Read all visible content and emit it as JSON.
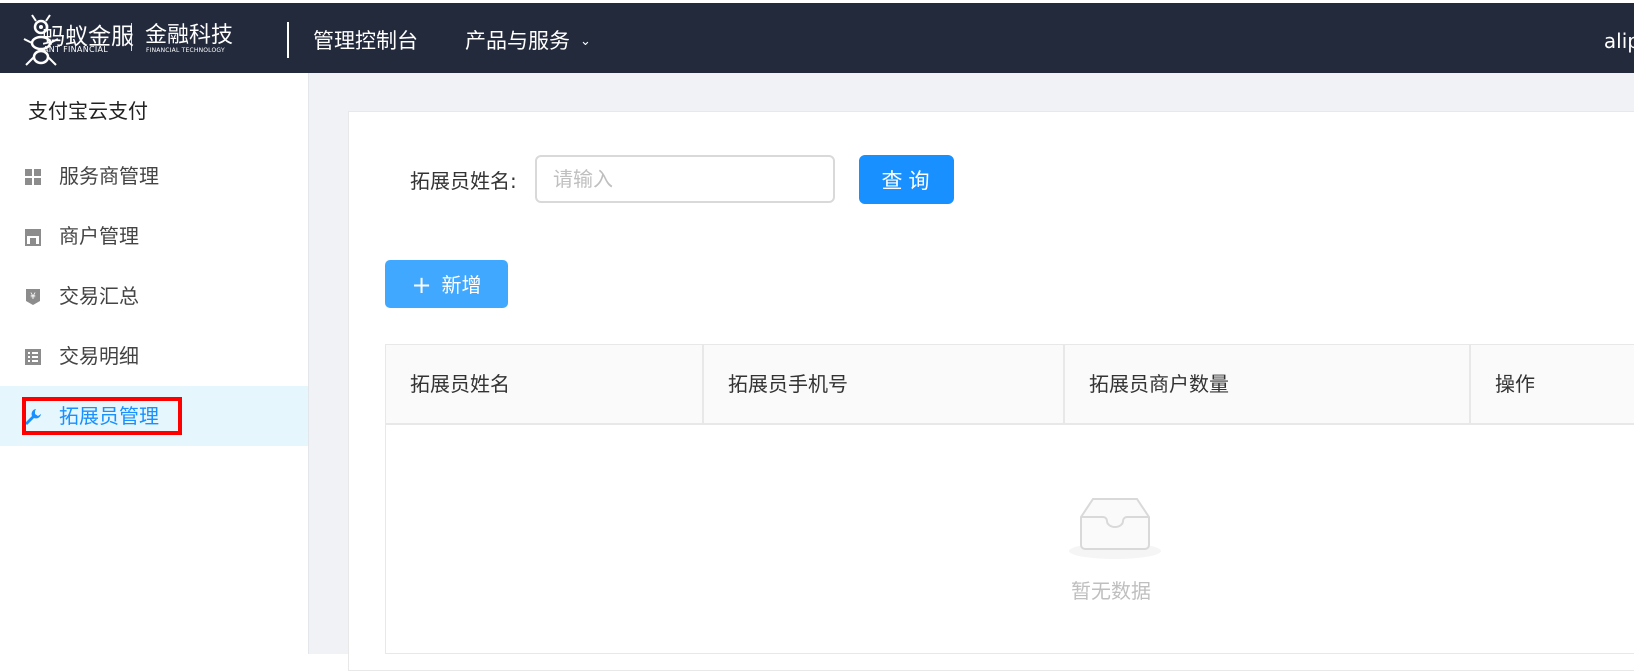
{
  "topbar": {
    "brand_cn": "蚂蚁金服",
    "brand_en": "ANT FINANCIAL",
    "brand2_cn": "金融科技",
    "brand2_en": "FINANCIAL TECHNOLOGY",
    "nav_console": "管理控制台",
    "nav_products": "产品与服务",
    "nav_products_chevron": "chevron-down-icon",
    "user": "alip",
    "bg_color": "#232a3c"
  },
  "sidebar": {
    "title": "支付宝云支付",
    "items": [
      {
        "label": "服务商管理",
        "icon": "grid-icon"
      },
      {
        "label": "商户管理",
        "icon": "store-icon"
      },
      {
        "label": "交易汇总",
        "icon": "yen-icon"
      },
      {
        "label": "交易明细",
        "icon": "list-icon"
      },
      {
        "label": "拓展员管理",
        "icon": "wrench-icon",
        "active": true
      }
    ],
    "active_color": "#1890ff",
    "active_bg": "#e6f6fd",
    "highlight_color": "#ff0000"
  },
  "search": {
    "label": "拓展员姓名:",
    "placeholder": "请输入",
    "value": "",
    "query_button": "查询"
  },
  "add_button": {
    "icon": "plus-icon",
    "label": "新增",
    "color": "#40a9ff"
  },
  "table": {
    "columns": [
      "拓展员姓名",
      "拓展员手机号",
      "拓展员商户数量",
      "操作"
    ],
    "rows": [],
    "empty_text": "暂无数据",
    "empty_icon": "inbox-icon"
  }
}
